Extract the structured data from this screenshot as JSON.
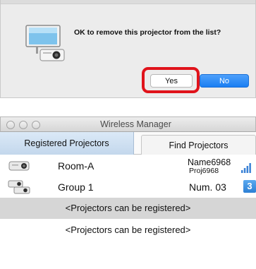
{
  "dialog": {
    "message": "OK to remove this projector from the list?",
    "yes_label": "Yes",
    "no_label": "No",
    "highlight_color": "#e0131b",
    "accent_color": "#1a7ef2"
  },
  "window": {
    "title": "Wireless Manager",
    "tabs": [
      {
        "label": "Registered Projectors",
        "active": true
      },
      {
        "label": "Find Projectors",
        "active": false
      }
    ],
    "projectors": [
      {
        "name": "Room-A",
        "info_line1": "Name6968",
        "info_line2": "Proj6968",
        "status_icon": "signal-bars-icon"
      },
      {
        "name": "Group 1",
        "info_line1": "Num. 03",
        "badge": "3",
        "status_icon": "group-badge-icon"
      }
    ],
    "empty_slots": [
      "<Projectors can be registered>",
      "<Projectors can be registered>"
    ]
  }
}
